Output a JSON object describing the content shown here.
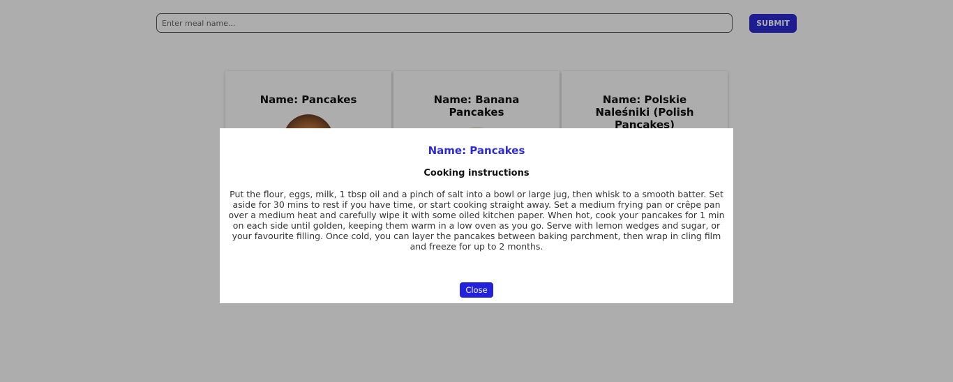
{
  "search": {
    "placeholder": "Enter meal name...",
    "submit_label": "SUBMIT"
  },
  "cards": [
    {
      "title": "Name: Pancakes"
    },
    {
      "title": "Name: Banana Pancakes"
    },
    {
      "title": "Name: Polskie Naleśniki (Polish Pancakes)"
    }
  ],
  "modal": {
    "title": "Name: Pancakes",
    "subtitle": "Cooking instructions",
    "instructions": "Put the flour, eggs, milk, 1 tbsp oil and a pinch of salt into a bowl or large jug, then whisk to a smooth batter. Set aside for 30 mins to rest if you have time, or start cooking straight away. Set a medium frying pan or crêpe pan over a medium heat and carefully wipe it with some oiled kitchen paper. When hot, cook your pancakes for 1 min on each side until golden, keeping them warm in a low oven as you go. Serve with lemon wedges and sugar, or your favourite filling. Once cold, you can layer the pancakes between baking parchment, then wrap in cling film and freeze for up to 2 months.",
    "close_label": "Close"
  },
  "colors": {
    "accent": "#2b2bd6",
    "overlay": "rgba(0,0,0,0.32)"
  }
}
